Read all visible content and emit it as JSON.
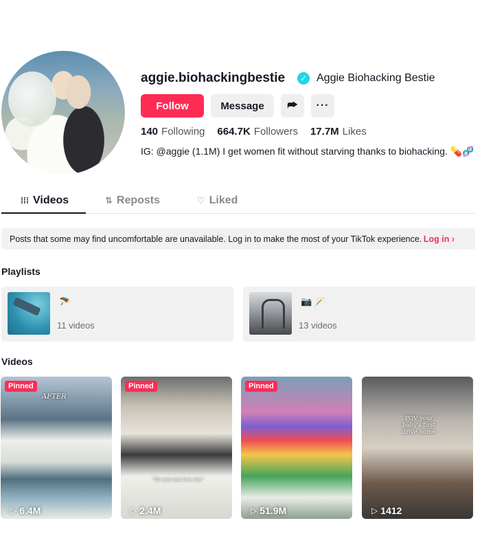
{
  "profile": {
    "username": "aggie.biohackingbestie",
    "nickname": "Aggie Biohacking Bestie",
    "verified_icon": "✓",
    "follow_label": "Follow",
    "message_label": "Message",
    "share_icon": "⮫",
    "more_icon": "···",
    "stats": {
      "following_count": "140",
      "following_label": "Following",
      "followers_count": "664.7K",
      "followers_label": "Followers",
      "likes_count": "17.7M",
      "likes_label": "Likes"
    },
    "bio": "IG: @aggie (1.1M) I get women fit without starving thanks to biohacking. 💊🧬"
  },
  "tabs": {
    "videos": "Videos",
    "reposts": "Reposts",
    "liked": "Liked",
    "videos_icon": "⁞⁞⁞",
    "reposts_icon": "⇅",
    "liked_icon": "♡"
  },
  "notice": {
    "text": "Posts that some may find uncomfortable are unavailable. Log in to make the most of your TikTok experience.",
    "login": "Log in ›"
  },
  "playlists_title": "Playlists",
  "playlists": [
    {
      "title": "🪂",
      "count": "11 videos"
    },
    {
      "title": "📷 🪄",
      "count": "13 videos"
    }
  ],
  "videos_title": "Videos",
  "videos": [
    {
      "pinned": "Pinned",
      "views": "6.4M",
      "overlay": "AFTER"
    },
    {
      "pinned": "Pinned",
      "views": "2.4M",
      "overlay": "\"Do you not love me\""
    },
    {
      "pinned": "Pinned",
      "views": "51.9M",
      "overlay": ""
    },
    {
      "pinned": "",
      "views": "1412",
      "overlay": "POV your baby's first drive home"
    }
  ],
  "play_icon": "▷"
}
